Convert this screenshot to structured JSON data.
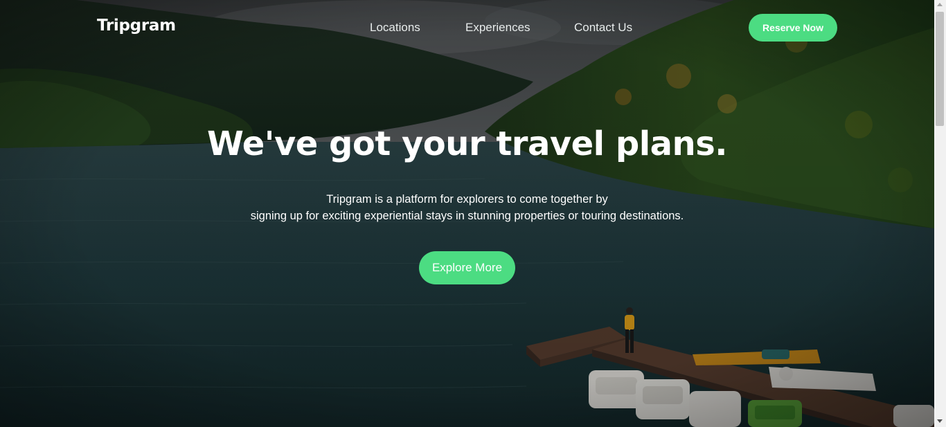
{
  "nav": {
    "brand": "Tripgram",
    "links": [
      "Locations",
      "Experiences",
      "Contact Us"
    ],
    "cta": "Reserve Now"
  },
  "hero": {
    "headline": "We've got your travel plans.",
    "description_line1": "Tripgram is a platform for explorers to come together by",
    "description_line2": "signing up for exciting experiential stays in stunning properties or touring destinations.",
    "button": "Explore More"
  },
  "colors": {
    "accent": "#4cdc82",
    "text": "#ffffff",
    "water": "#1f3a3e",
    "forest": "#1f3a1e",
    "sky": "#4a4d4f"
  }
}
